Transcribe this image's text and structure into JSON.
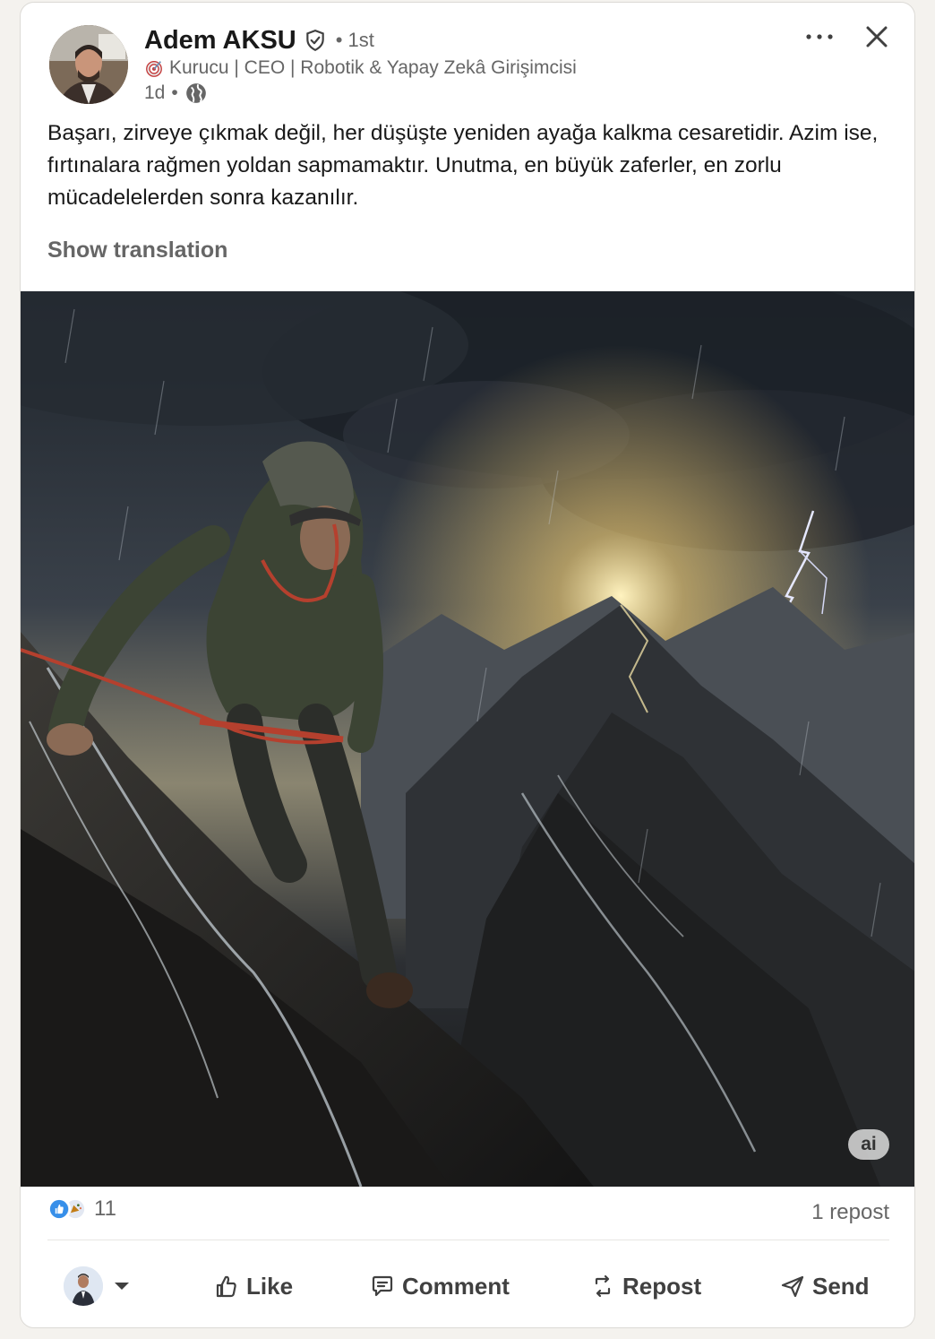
{
  "author": {
    "name": "Adem AKSU",
    "degree": "• 1st",
    "headline": "Kurucu | CEO | Robotik & Yapay Zekâ Girişimcisi",
    "time": "1d",
    "separator": "•"
  },
  "post": {
    "text": "Başarı, zirveye çıkmak değil, her düşüşte yeniden ayağa kalkma cesaretidir. Azim ise, fırtınalara rağmen yoldan sapmamaktır. Unutma, en büyük zaferler, en zorlu mücadelelerden sonra kazanılır.",
    "translate_label": "Show translation",
    "media_badge": "ai"
  },
  "social": {
    "reaction_count": "11",
    "repost_count": "1 repost"
  },
  "actions": {
    "like": "Like",
    "comment": "Comment",
    "repost": "Repost",
    "send": "Send"
  },
  "icons": {
    "verified": "verified-shield-icon",
    "headline": "target-icon",
    "visibility": "globe-icon",
    "more": "ellipsis-icon",
    "close": "close-icon"
  },
  "colors": {
    "background": "#f4f2ee",
    "card": "#ffffff",
    "text_primary": "#191919",
    "text_secondary": "#666666",
    "reaction_like": "#378fe9",
    "reaction_celebrate": "#44712e"
  }
}
